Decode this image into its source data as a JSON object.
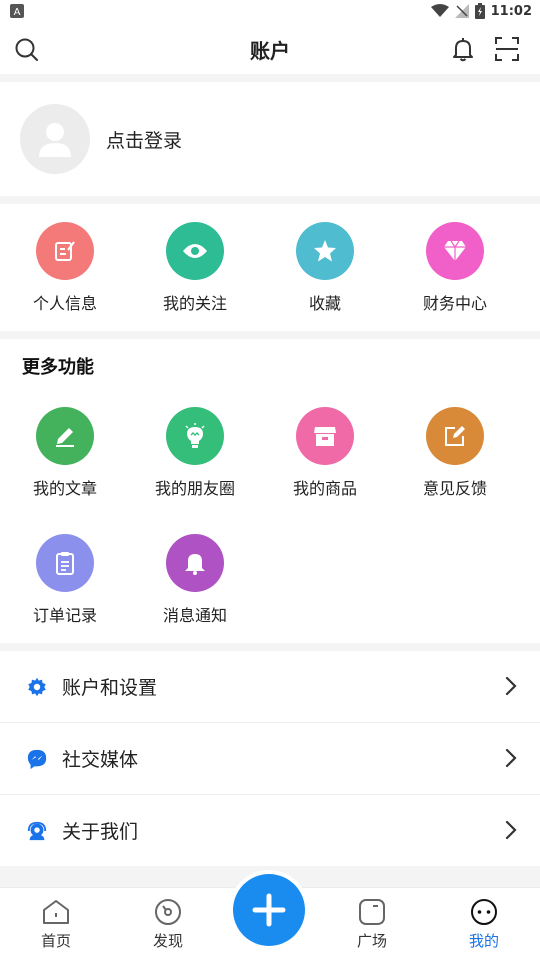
{
  "status_bar": {
    "time": "11:02"
  },
  "header": {
    "title": "账户"
  },
  "profile": {
    "login_label": "点击登录"
  },
  "quick_actions": [
    {
      "label": "个人信息",
      "color": "#f47a7a",
      "icon": "edit-note-icon"
    },
    {
      "label": "我的关注",
      "color": "#2ebc95",
      "icon": "eye-icon"
    },
    {
      "label": "收藏",
      "color": "#4fbcd0",
      "icon": "star-icon"
    },
    {
      "label": "财务中心",
      "color": "#f060c8",
      "icon": "diamond-icon"
    }
  ],
  "more": {
    "title": "更多功能",
    "items": [
      {
        "label": "我的文章",
        "color": "#44b25c",
        "icon": "pencil-icon"
      },
      {
        "label": "我的朋友圈",
        "color": "#35be7a",
        "icon": "lightbulb-icon"
      },
      {
        "label": "我的商品",
        "color": "#f06aa8",
        "icon": "store-icon"
      },
      {
        "label": "意见反馈",
        "color": "#d88a38",
        "icon": "feedback-icon"
      },
      {
        "label": "订单记录",
        "color": "#8b90ec",
        "icon": "clipboard-icon"
      },
      {
        "label": "消息通知",
        "color": "#ae52c4",
        "icon": "bell-icon"
      }
    ]
  },
  "menu": [
    {
      "label": "账户和设置",
      "icon": "gear-icon"
    },
    {
      "label": "社交媒体",
      "icon": "messenger-icon"
    },
    {
      "label": "关于我们",
      "icon": "support-icon"
    }
  ],
  "bottom_nav": [
    {
      "label": "首页",
      "icon": "home-icon"
    },
    {
      "label": "发现",
      "icon": "compass-icon"
    },
    {
      "label": "广场",
      "icon": "square-icon"
    },
    {
      "label": "我的",
      "icon": "smile-icon",
      "active": true
    }
  ],
  "colors": {
    "accent": "#1a73e8",
    "fab": "#1a8cf0"
  }
}
